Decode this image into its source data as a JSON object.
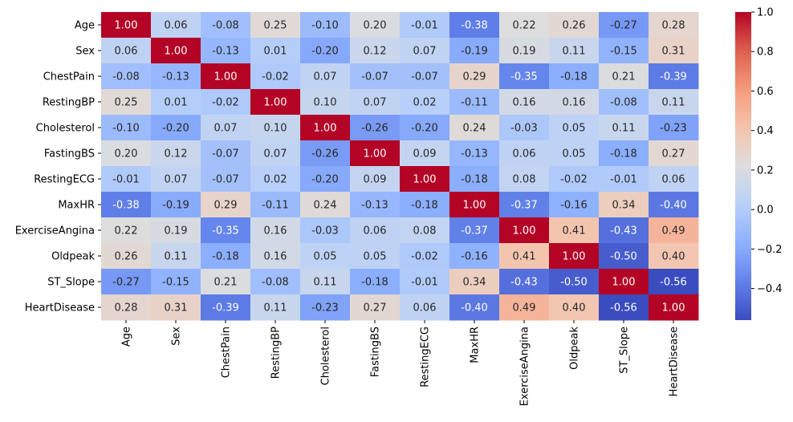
{
  "chart_data": {
    "type": "heatmap",
    "title": "",
    "xlabel": "",
    "ylabel": "",
    "colormap": "coolwarm",
    "annot_format": "0.00",
    "labels": [
      "Age",
      "Sex",
      "ChestPain",
      "RestingBP",
      "Cholesterol",
      "FastingBS",
      "RestingECG",
      "MaxHR",
      "ExerciseAngina",
      "Oldpeak",
      "ST_Slope",
      "HeartDisease"
    ],
    "matrix": [
      [
        1.0,
        0.06,
        -0.08,
        0.25,
        -0.1,
        0.2,
        -0.01,
        -0.38,
        0.22,
        0.26,
        -0.27,
        0.28
      ],
      [
        0.06,
        1.0,
        -0.13,
        0.01,
        -0.2,
        0.12,
        0.07,
        -0.19,
        0.19,
        0.11,
        -0.15,
        0.31
      ],
      [
        -0.08,
        -0.13,
        1.0,
        -0.02,
        0.07,
        -0.07,
        -0.07,
        0.29,
        -0.35,
        -0.18,
        0.21,
        -0.39
      ],
      [
        0.25,
        0.01,
        -0.02,
        1.0,
        0.1,
        0.07,
        0.02,
        -0.11,
        0.16,
        0.16,
        -0.08,
        0.11
      ],
      [
        -0.1,
        -0.2,
        0.07,
        0.1,
        1.0,
        -0.26,
        -0.2,
        0.24,
        -0.03,
        0.05,
        0.11,
        -0.23
      ],
      [
        0.2,
        0.12,
        -0.07,
        0.07,
        -0.26,
        1.0,
        0.09,
        -0.13,
        0.06,
        0.05,
        -0.18,
        0.27
      ],
      [
        -0.01,
        0.07,
        -0.07,
        0.02,
        -0.2,
        0.09,
        1.0,
        -0.18,
        0.08,
        -0.02,
        -0.01,
        0.06
      ],
      [
        -0.38,
        -0.19,
        0.29,
        -0.11,
        0.24,
        -0.13,
        -0.18,
        1.0,
        -0.37,
        -0.16,
        0.34,
        -0.4
      ],
      [
        0.22,
        0.19,
        -0.35,
        0.16,
        -0.03,
        0.06,
        0.08,
        -0.37,
        1.0,
        0.41,
        -0.43,
        0.49
      ],
      [
        0.26,
        0.11,
        -0.18,
        0.16,
        0.05,
        0.05,
        -0.02,
        -0.16,
        0.41,
        1.0,
        -0.5,
        0.4
      ],
      [
        -0.27,
        -0.15,
        0.21,
        -0.08,
        0.11,
        -0.18,
        -0.01,
        0.34,
        -0.43,
        -0.5,
        1.0,
        -0.56
      ],
      [
        0.28,
        0.31,
        -0.39,
        0.11,
        -0.23,
        0.27,
        0.06,
        -0.4,
        0.49,
        0.4,
        -0.56,
        1.0
      ]
    ],
    "vmin": -0.56,
    "vmax": 1.0,
    "colorbar": {
      "ticks": [
        1.0,
        0.8,
        0.6,
        0.4,
        0.2,
        0.0,
        -0.2,
        -0.4
      ],
      "tick_labels": [
        "1.0",
        "0.8",
        "0.6",
        "0.4",
        "0.2",
        "0.0",
        "−0.2",
        "−0.4"
      ],
      "placement": "right"
    },
    "grid": false
  }
}
